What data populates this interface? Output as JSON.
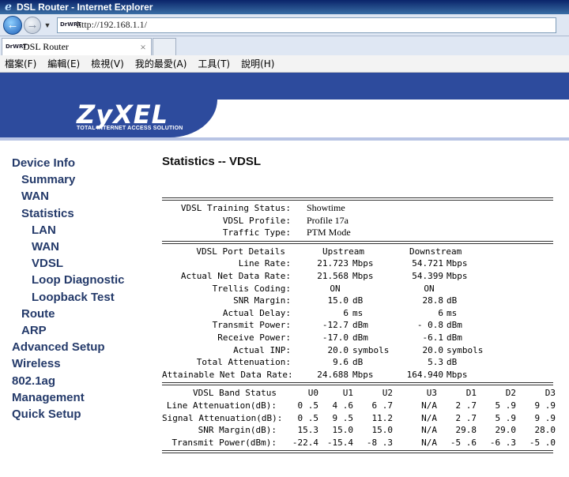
{
  "window": {
    "title": "DSL Router - Internet Explorer"
  },
  "address_bar": {
    "url": "http://192.168.1.1/",
    "site_icon": "DrWRT"
  },
  "tab": {
    "label": "DSL Router"
  },
  "menu": [
    "檔案(F)",
    "編輯(E)",
    "檢視(V)",
    "我的最愛(A)",
    "工具(T)",
    "說明(H)"
  ],
  "brand": {
    "logo": "ZyXEL",
    "tagline": "TOTAL INTERNET ACCESS SOLUTION",
    "color": "#2d4b9d"
  },
  "sidebar": [
    {
      "label": "Device Info",
      "level": 0
    },
    {
      "label": "Summary",
      "level": 1
    },
    {
      "label": "WAN",
      "level": 1
    },
    {
      "label": "Statistics",
      "level": 1
    },
    {
      "label": "LAN",
      "level": 2
    },
    {
      "label": "WAN",
      "level": 2
    },
    {
      "label": "VDSL",
      "level": 2
    },
    {
      "label": "Loop Diagnostic",
      "level": 2
    },
    {
      "label": "Loopback Test",
      "level": 2
    },
    {
      "label": "Route",
      "level": 1
    },
    {
      "label": "ARP",
      "level": 1
    },
    {
      "label": "Advanced Setup",
      "level": 0
    },
    {
      "label": "Wireless",
      "level": 0
    },
    {
      "label": "802.1ag",
      "level": 0
    },
    {
      "label": "Management",
      "level": 0
    },
    {
      "label": "Quick Setup",
      "level": 0
    }
  ],
  "page": {
    "title": "Statistics -- VDSL"
  },
  "status": {
    "training_label": "VDSL Training Status:",
    "training_value": "Showtime",
    "profile_label": "VDSL Profile:",
    "profile_value": "Profile 17a",
    "traffic_label": "Traffic Type:",
    "traffic_value": "PTM Mode"
  },
  "port": {
    "header": [
      "VDSL Port Details",
      "Upstream",
      "Downstream"
    ],
    "rows": [
      {
        "label": "Line Rate:",
        "up": "21.723",
        "up_unit": "Mbps",
        "down": "54.721",
        "down_unit": "Mbps"
      },
      {
        "label": "Actual Net Data Rate:",
        "up": "21.568",
        "up_unit": "Mbps",
        "down": "54.399",
        "down_unit": "Mbps"
      },
      {
        "label": "Trellis Coding:",
        "up": "ON",
        "up_unit": "",
        "down": "ON",
        "down_unit": ""
      },
      {
        "label": "SNR Margin:",
        "up": "15.0",
        "up_unit": "dB",
        "down": "28.8",
        "down_unit": "dB"
      },
      {
        "label": "Actual Delay:",
        "up": "6",
        "up_unit": "ms",
        "down": "6",
        "down_unit": "ms"
      },
      {
        "label": "Transmit Power:",
        "up": "-12.7",
        "up_unit": "dBm",
        "down": "- 0.8",
        "down_unit": "dBm"
      },
      {
        "label": "Receive Power:",
        "up": "-17.0",
        "up_unit": "dBm",
        "down": "-6.1",
        "down_unit": "dBm"
      },
      {
        "label": "Actual INP:",
        "up": "20.0",
        "up_unit": "symbols",
        "down": "20.0",
        "down_unit": "symbols"
      },
      {
        "label": "Total Attenuation:",
        "up": "9.6",
        "up_unit": "dB",
        "down": "5.3",
        "down_unit": "dB"
      },
      {
        "label": "Attainable Net Data Rate:",
        "up": "24.688",
        "up_unit": "Mbps",
        "down": "164.940",
        "down_unit": "Mbps"
      }
    ]
  },
  "band": {
    "header": [
      "VDSL Band Status",
      "U0",
      "U1",
      "U2",
      "U3",
      "D1",
      "D2",
      "D3"
    ],
    "rows": [
      {
        "label": "Line Attenuation(dB):",
        "v": [
          "0 .5",
          "4 .6",
          "6 .7",
          "N/A",
          "2 .7",
          "5 .9",
          "9 .9"
        ]
      },
      {
        "label": "Signal Attenuation(dB):",
        "v": [
          "0 .5",
          "9 .5",
          "11.2",
          "N/A",
          "2 .7",
          "5 .9",
          "9 .9"
        ]
      },
      {
        "label": "SNR Margin(dB):",
        "v": [
          "15.3",
          "15.0",
          "15.0",
          "N/A",
          "29.8",
          "29.0",
          "28.0"
        ]
      },
      {
        "label": "Transmit Power(dBm):",
        "v": [
          "-22.4",
          "-15.4",
          "-8 .3",
          "N/A",
          "-5 .6",
          "-6 .3",
          "-5 .0"
        ]
      }
    ]
  }
}
